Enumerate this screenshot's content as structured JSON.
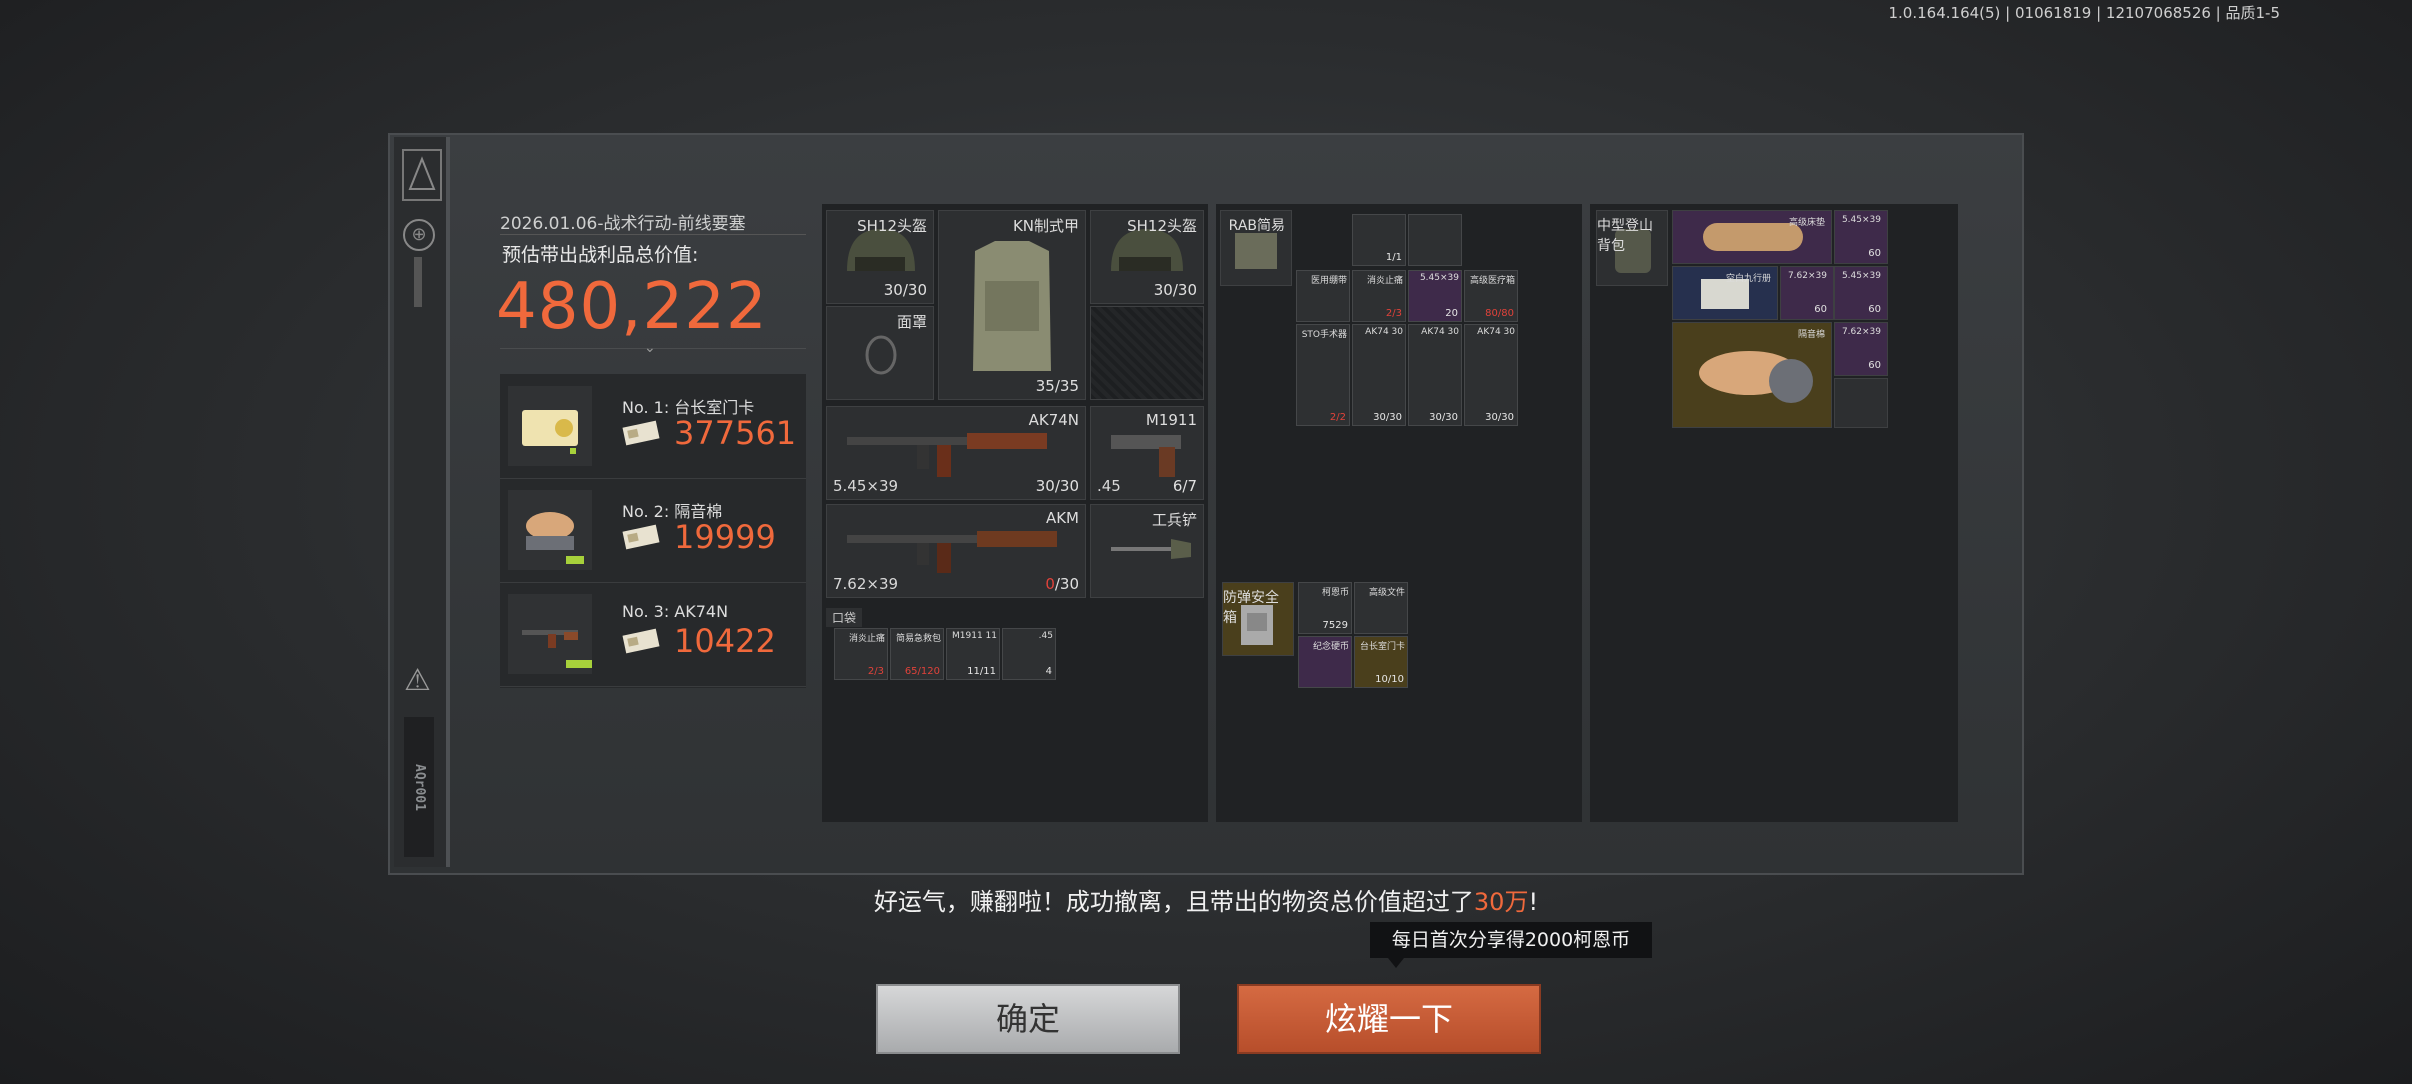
{
  "version": "1.0.164.164(5) | 01061819 | 12107068526 | 品质1-5",
  "header": {
    "title": "2026.01.06-战术行动-前线要塞",
    "est_label": "预估带出战利品总价值:",
    "total": "480,222"
  },
  "side": {
    "code": "AQr001"
  },
  "top_items": [
    {
      "label": "No. 1: 台长室门卡",
      "value": "377561"
    },
    {
      "label": "No. 2: 隔音棉",
      "value": "19999"
    },
    {
      "label": "No. 3: AK74N",
      "value": "10422"
    }
  ],
  "gear": {
    "helmet_left": {
      "name": "SH12头盔",
      "count": "30/30"
    },
    "armor": {
      "name": "KN制式甲",
      "count": "35/35"
    },
    "helmet_right": {
      "name": "SH12头盔",
      "count": "30/30"
    },
    "mask": {
      "name": "面罩"
    },
    "gun1": {
      "name": "AK74N",
      "caliber": "5.45×39",
      "count": "30/30"
    },
    "pistol": {
      "name": "M1911",
      "caliber": ".45",
      "count": "6/7"
    },
    "gun2": {
      "name": "AKM",
      "caliber": "7.62×39",
      "count_a": "0",
      "count_b": "/30"
    },
    "shovel": {
      "name": "工兵铲"
    },
    "pocket": {
      "label": "口袋"
    }
  },
  "pocket_items": [
    {
      "label": "消炎止痛",
      "count": "2/3",
      "red": true
    },
    {
      "label": "简易急救包",
      "count": "65/120",
      "red": true
    },
    {
      "label": "M1911 11",
      "count": "11/11",
      "red": false
    },
    {
      "label": ".45",
      "count": "4",
      "red": false
    }
  ],
  "rig": {
    "name": "RAB简易",
    "items": [
      {
        "label": "",
        "count": "1/1"
      },
      {
        "label": "",
        "count": ""
      },
      {
        "label": "医用绷带",
        "count": ""
      },
      {
        "label": "消炎止痛",
        "count": "2/3"
      },
      {
        "label": "5.45×39",
        "count": "20"
      },
      {
        "label": "高级医疗箱",
        "count": "80/80"
      },
      {
        "label": "STO手术器",
        "count": "2/2"
      },
      {
        "label": "AK74 30",
        "count": "30/30"
      },
      {
        "label": "AK74 30",
        "count": "30/30"
      },
      {
        "label": "AK74 30",
        "count": "30/30"
      }
    ]
  },
  "safe": {
    "name": "防弹安全箱",
    "items": [
      {
        "label": "柯恩币",
        "count": "7529"
      },
      {
        "label": "高级文件",
        "count": ""
      },
      {
        "label": "纪念硬币",
        "count": ""
      },
      {
        "label": "台长室门卡",
        "count": "10/10"
      }
    ]
  },
  "backpack": {
    "name": "中型登山背包",
    "items": [
      {
        "label": "高级床垫",
        "count": ""
      },
      {
        "label": "5.45×39",
        "count": "60"
      },
      {
        "label": "空白九行册",
        "count": ""
      },
      {
        "label": "7.62×39",
        "count": "60"
      },
      {
        "label": "5.45×39",
        "count": "60"
      },
      {
        "label": "隔音棉",
        "count": ""
      },
      {
        "label": "7.62×39",
        "count": "60"
      }
    ]
  },
  "message": {
    "pre": "好运气，赚翻啦！成功撤离，且带出的物资总价值超过了",
    "highlight": "30万",
    "post": "!"
  },
  "tip": "每日首次分享得2000柯恩币",
  "buttons": {
    "confirm": "确定",
    "show": "炫耀一下"
  },
  "colors": {
    "accent": "#f0693c",
    "confirm": "#c2c4c6",
    "show": "#c75a35"
  }
}
